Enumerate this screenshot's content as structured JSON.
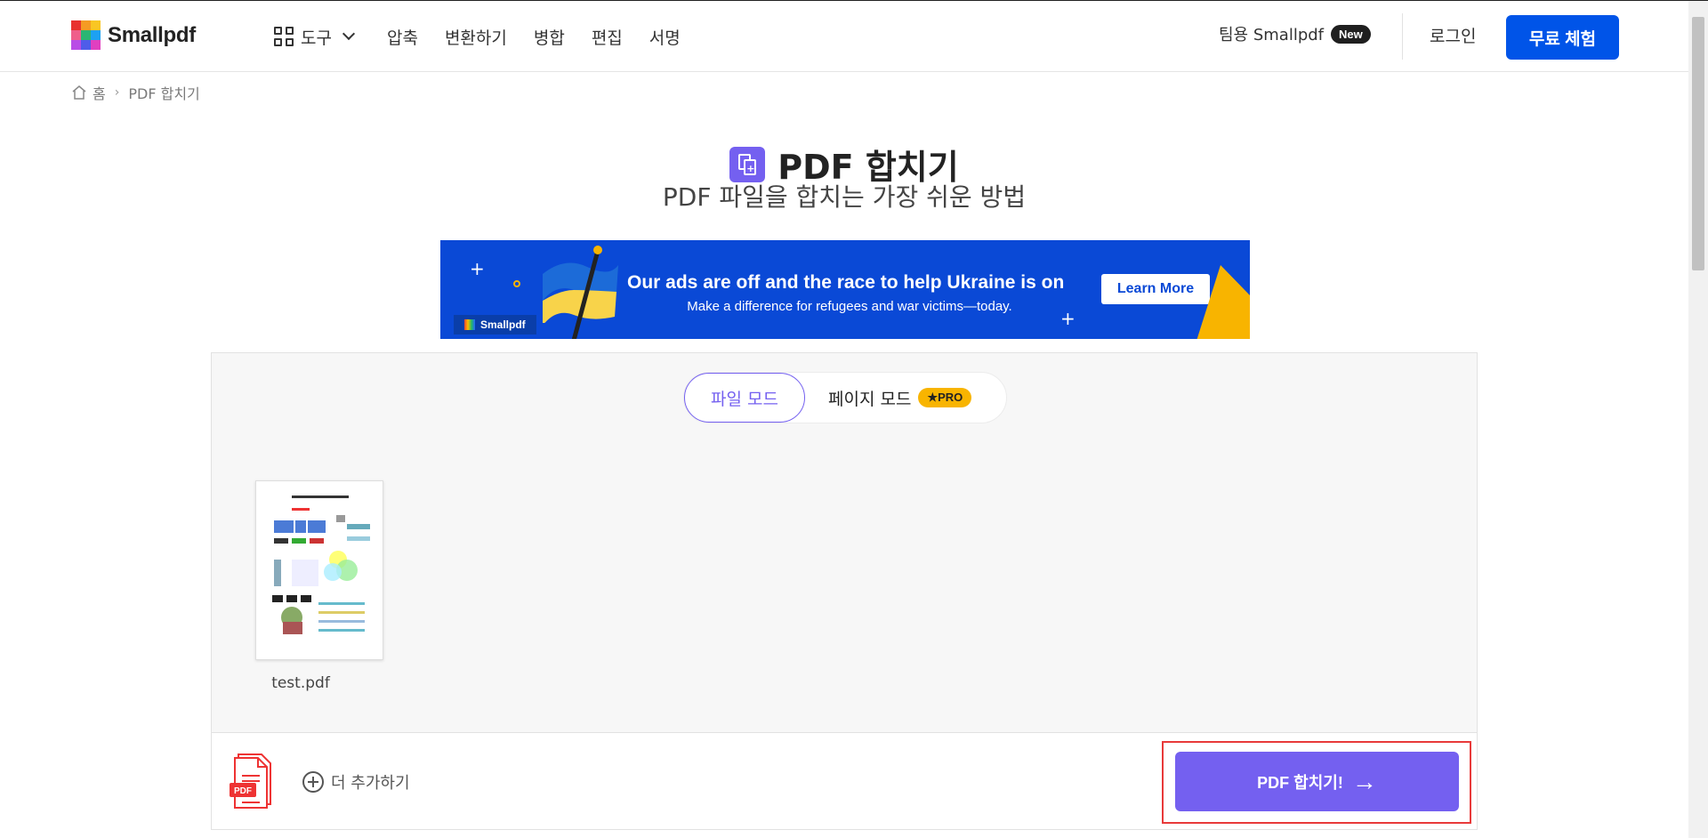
{
  "header": {
    "logo_text": "Smallpdf",
    "tools_label": "도구",
    "nav": [
      "압축",
      "변환하기",
      "병합",
      "편집",
      "서명"
    ],
    "team_label": "팀용 Smallpdf",
    "team_badge": "New",
    "login_label": "로그인",
    "trial_label": "무료 체험"
  },
  "breadcrumb": {
    "home": "홈",
    "separator": "›",
    "current": "PDF 합치기"
  },
  "page": {
    "title": "PDF 합치기",
    "subtitle": "PDF 파일을 합치는 가장 쉬운 방법"
  },
  "banner": {
    "headline": "Our ads are off and the race to help Ukraine is on",
    "subline": "Make a difference for refugees and war victims—today.",
    "button": "Learn More",
    "logo_text": "Smallpdf"
  },
  "modes": {
    "file_mode": "파일 모드",
    "page_mode": "페이지 모드",
    "pro_badge": "★PRO"
  },
  "files": [
    {
      "name": "test.pdf"
    }
  ],
  "actions": {
    "add_more": "더 추가하기",
    "merge": "PDF 합치기!",
    "pdf_icon_label": "PDF"
  },
  "colors": {
    "accent": "#7460f0",
    "primary": "#0054e8",
    "banner_bg": "#0a49d6",
    "highlight": "#e83a3a",
    "pro": "#f8b400"
  }
}
